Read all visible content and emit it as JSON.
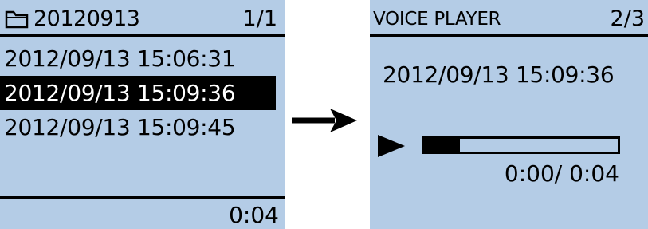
{
  "folder_screen": {
    "folder_name": "20120913",
    "page_counter": "1/1",
    "files": [
      {
        "label": "2012/09/13 15:06:31",
        "selected": false
      },
      {
        "label": "2012/09/13 15:09:36",
        "selected": true
      },
      {
        "label": "2012/09/13 15:09:45",
        "selected": false
      }
    ],
    "selected_duration": "0:04",
    "icon": "folder-icon"
  },
  "transition": {
    "icon": "right-arrow-icon"
  },
  "player_screen": {
    "title": "VOICE PLAYER",
    "page_counter": "2/3",
    "recording_timestamp": "2012/09/13 15:09:36",
    "status_icon": "play-icon",
    "progress_fraction": 0.18,
    "elapsed": "0:00",
    "separator": "/ ",
    "total": "0:04"
  },
  "colors": {
    "lcd_background": "#b4cce6",
    "foreground": "#000000",
    "selection_text": "#ffffff"
  }
}
